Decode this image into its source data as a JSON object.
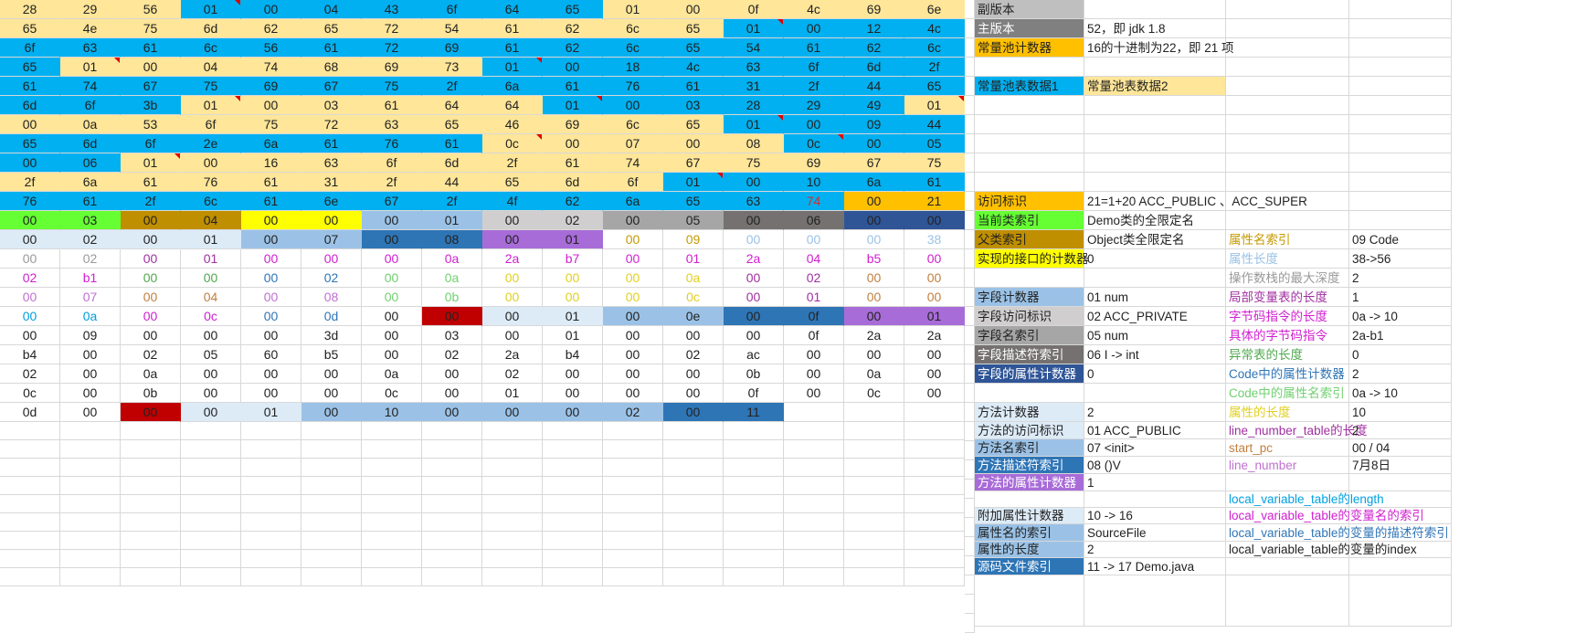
{
  "hex_rows": [
    [
      "28",
      "29",
      "56",
      "01",
      "00",
      "04",
      "43",
      "6f",
      "64",
      "65",
      "01",
      "00",
      "0f",
      "4c",
      "69",
      "6e"
    ],
    [
      "65",
      "4e",
      "75",
      "6d",
      "62",
      "65",
      "72",
      "54",
      "61",
      "62",
      "6c",
      "65",
      "01",
      "00",
      "12",
      "4c"
    ],
    [
      "6f",
      "63",
      "61",
      "6c",
      "56",
      "61",
      "72",
      "69",
      "61",
      "62",
      "6c",
      "65",
      "54",
      "61",
      "62",
      "6c"
    ],
    [
      "65",
      "01",
      "00",
      "04",
      "74",
      "68",
      "69",
      "73",
      "01",
      "00",
      "18",
      "4c",
      "63",
      "6f",
      "6d",
      "2f"
    ],
    [
      "61",
      "74",
      "67",
      "75",
      "69",
      "67",
      "75",
      "2f",
      "6a",
      "61",
      "76",
      "61",
      "31",
      "2f",
      "44",
      "65"
    ],
    [
      "6d",
      "6f",
      "3b",
      "01",
      "00",
      "03",
      "61",
      "64",
      "64",
      "01",
      "00",
      "03",
      "28",
      "29",
      "49",
      "01"
    ],
    [
      "00",
      "0a",
      "53",
      "6f",
      "75",
      "72",
      "63",
      "65",
      "46",
      "69",
      "6c",
      "65",
      "01",
      "00",
      "09",
      "44"
    ],
    [
      "65",
      "6d",
      "6f",
      "2e",
      "6a",
      "61",
      "76",
      "61",
      "0c",
      "00",
      "07",
      "00",
      "08",
      "0c",
      "00",
      "05"
    ],
    [
      "00",
      "06",
      "01",
      "00",
      "16",
      "63",
      "6f",
      "6d",
      "2f",
      "61",
      "74",
      "67",
      "75",
      "69",
      "67",
      "75"
    ],
    [
      "2f",
      "6a",
      "61",
      "76",
      "61",
      "31",
      "2f",
      "44",
      "65",
      "6d",
      "6f",
      "01",
      "00",
      "10",
      "6a",
      "61"
    ],
    [
      "76",
      "61",
      "2f",
      "6c",
      "61",
      "6e",
      "67",
      "2f",
      "4f",
      "62",
      "6a",
      "65",
      "63",
      "74",
      "00",
      "21"
    ],
    [
      "00",
      "03",
      "00",
      "04",
      "00",
      "00",
      "00",
      "01",
      "00",
      "02",
      "00",
      "05",
      "00",
      "06",
      "00",
      "00"
    ],
    [
      "00",
      "02",
      "00",
      "01",
      "00",
      "07",
      "00",
      "08",
      "00",
      "01",
      "00",
      "09",
      "00",
      "00",
      "00",
      "38"
    ],
    [
      "00",
      "02",
      "00",
      "01",
      "00",
      "00",
      "00",
      "0a",
      "2a",
      "b7",
      "00",
      "01",
      "2a",
      "04",
      "b5",
      "00"
    ],
    [
      "02",
      "b1",
      "00",
      "00",
      "00",
      "02",
      "00",
      "0a",
      "00",
      "00",
      "00",
      "0a",
      "00",
      "02",
      "00",
      "00"
    ],
    [
      "00",
      "07",
      "00",
      "04",
      "00",
      "08",
      "00",
      "0b",
      "00",
      "00",
      "00",
      "0c",
      "00",
      "01",
      "00",
      "00"
    ],
    [
      "00",
      "0a",
      "00",
      "0c",
      "00",
      "0d",
      "00",
      "00",
      "00",
      "01",
      "00",
      "0e",
      "00",
      "0f",
      "00",
      "01"
    ],
    [
      "00",
      "09",
      "00",
      "00",
      "00",
      "3d",
      "00",
      "03",
      "00",
      "01",
      "00",
      "00",
      "00",
      "0f",
      "2a",
      "2a"
    ],
    [
      "b4",
      "00",
      "02",
      "05",
      "60",
      "b5",
      "00",
      "02",
      "2a",
      "b4",
      "00",
      "02",
      "ac",
      "00",
      "00",
      "00"
    ],
    [
      "02",
      "00",
      "0a",
      "00",
      "00",
      "00",
      "0a",
      "00",
      "02",
      "00",
      "00",
      "00",
      "0b",
      "00",
      "0a",
      "00"
    ],
    [
      "0c",
      "00",
      "0b",
      "00",
      "00",
      "00",
      "0c",
      "00",
      "01",
      "00",
      "00",
      "00",
      "0f",
      "00",
      "0c",
      "00"
    ],
    [
      "0d",
      "00",
      "00",
      "00",
      "01",
      "00",
      "10",
      "00",
      "00",
      "00",
      "02",
      "00",
      "11",
      "",
      "",
      ""
    ]
  ],
  "legend_rows": [
    {
      "c1": "副版本",
      "c2": "",
      "c3": "",
      "c4": ""
    },
    {
      "c1": "主版本",
      "c2": "52，即 jdk 1.8",
      "c3": "",
      "c4": ""
    },
    {
      "c1": "常量池计数器",
      "c2": "16的十进制为22，即 21 项",
      "c3": "",
      "c4": ""
    },
    {
      "c1": "",
      "c2": "",
      "c3": "",
      "c4": ""
    },
    {
      "c1": "常量池表数据1",
      "c2": "常量池表数据2",
      "c3": "",
      "c4": ""
    },
    {
      "c1": "",
      "c2": "",
      "c3": "",
      "c4": ""
    },
    {
      "c1": "",
      "c2": "",
      "c3": "",
      "c4": ""
    },
    {
      "c1": "",
      "c2": "",
      "c3": "",
      "c4": ""
    },
    {
      "c1": "",
      "c2": "",
      "c3": "",
      "c4": ""
    },
    {
      "c1": "",
      "c2": "",
      "c3": "",
      "c4": ""
    },
    {
      "c1": "访问标识",
      "c2": "21=1+20 ACC_PUBLIC 、ACC_SUPER",
      "c3": "",
      "c4": ""
    },
    {
      "c1": "当前类索引",
      "c2": "Demo类的全限定名",
      "c3": "",
      "c4": ""
    },
    {
      "c1": "父类索引",
      "c2": "Object类全限定名",
      "c3": "属性名索引",
      "c4": "09 Code"
    },
    {
      "c1": "实现的接口的计数器",
      "c2": "0",
      "c3": "属性长度",
      "c4": "38->56"
    },
    {
      "c1": "",
      "c2": "",
      "c3": "操作数栈的最大深度",
      "c4": "2"
    },
    {
      "c1": "字段计数器",
      "c2": "01 num",
      "c3": "局部变量表的长度",
      "c4": "1"
    },
    {
      "c1": "字段访问标识",
      "c2": "02 ACC_PRIVATE",
      "c3": "字节码指令的长度",
      "c4": "0a -> 10"
    },
    {
      "c1": "字段名索引",
      "c2": "05 num",
      "c3": "具体的字节码指令",
      "c4": "2a-b1"
    },
    {
      "c1": "字段描述符索引",
      "c2": "06 I   -> int",
      "c3": "异常表的长度",
      "c4": "0"
    },
    {
      "c1": "字段的属性计数器",
      "c2": "0",
      "c3": "Code中的属性计数器",
      "c4": "2"
    },
    {
      "c1": "",
      "c2": "",
      "c3": "Code中的属性名索引",
      "c4": "0a -> 10"
    },
    {
      "c1": "方法计数器",
      "c2": "2",
      "c3": "属性的长度",
      "c4": "10"
    },
    {
      "c1": "方法的访问标识",
      "c2": "01 ACC_PUBLIC",
      "c3": "line_number_table的长度",
      "c4": "2"
    },
    {
      "c1": "方法名索引",
      "c2": "07 <init>",
      "c3": "start_pc",
      "c4": "00 / 04"
    },
    {
      "c1": "方法描述符索引",
      "c2": "08 ()V",
      "c3": "line_number",
      "c4": "7月8日"
    },
    {
      "c1": "方法的属性计数器",
      "c2": "1",
      "c3": "",
      "c4": ""
    },
    {
      "c1": "",
      "c2": "",
      "c3": "local_variable_table的length",
      "c4": ""
    },
    {
      "c1": "附加属性计数器",
      "c2": "10 -> 16",
      "c3": "local_variable_table的变量名的索引",
      "c4": ""
    },
    {
      "c1": "属性名的索引",
      "c2": "SourceFile",
      "c3": "local_variable_table的变量的描述符索引",
      "c4": ""
    },
    {
      "c1": "属性的长度",
      "c2": "2",
      "c3": "local_variable_table的变量的index",
      "c4": ""
    },
    {
      "c1": "源码文件索引",
      "c2": "11 -> 17 Demo.java",
      "c3": "",
      "c4": ""
    }
  ],
  "colors": {
    "grid_line": "#d8d8d8",
    "peach": "#ffe699",
    "cyan": "#00b0f0",
    "orange": "#ffc000",
    "light_gray": "#bfbfbf",
    "dark_gray": "#808080",
    "green": "#66ff33",
    "olive": "#bf8f00",
    "yellow": "#ffff00",
    "light_blue": "#9bc2e6",
    "silver": "#d0cece",
    "gray_mid": "#a6a6a6",
    "gray_dark": "#757171",
    "navy": "#2f5597",
    "pale_blue": "#ddebf7",
    "steel_blue": "#2e75b6",
    "purple": "#a86cd8",
    "red": "#c00000",
    "note_marker": "#e00000"
  }
}
